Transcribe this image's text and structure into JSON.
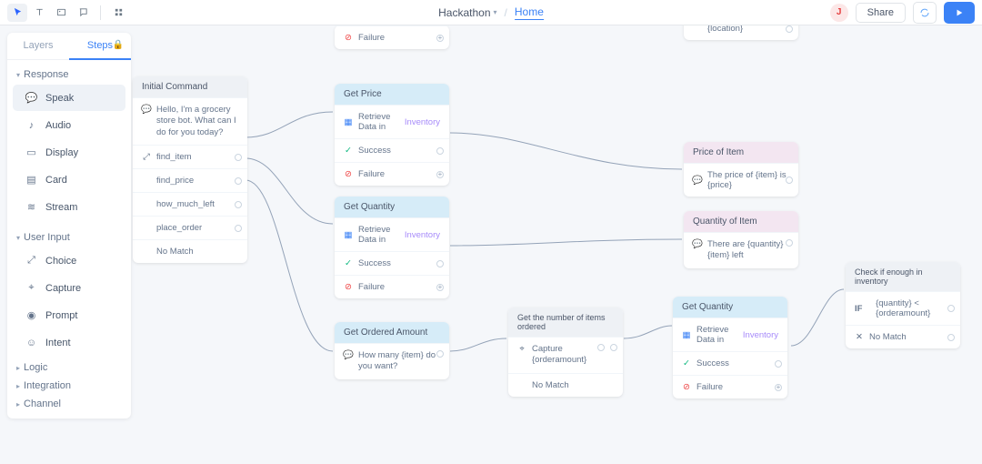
{
  "topbar": {
    "project": "Hackathon",
    "breadcrumb": "Home",
    "share": "Share",
    "avatar": "J"
  },
  "sidebar": {
    "tabs": {
      "layers": "Layers",
      "steps": "Steps"
    },
    "sections": {
      "response": {
        "title": "Response",
        "items": {
          "speak": "Speak",
          "audio": "Audio",
          "display": "Display",
          "card": "Card",
          "stream": "Stream"
        }
      },
      "userinput": {
        "title": "User Input",
        "items": {
          "choice": "Choice",
          "capture": "Capture",
          "prompt": "Prompt",
          "intent": "Intent"
        }
      },
      "logic": "Logic",
      "integration": "Integration",
      "channel": "Channel"
    }
  },
  "nodes": {
    "initial": {
      "title": "Initial Command",
      "greet": "Hello, I'm a grocery store bot. What can I do for you today?",
      "intents": {
        "find_item": "find_item",
        "find_price": "find_price",
        "how_much": "how_much_left",
        "place_order": "place_order",
        "nomatch": "No Match"
      }
    },
    "topfail": {
      "failure": "Failure"
    },
    "getprice": {
      "title": "Get Price",
      "retrieve": "Retrieve Data in ",
      "inventory": "Inventory",
      "success": "Success",
      "failure": "Failure"
    },
    "getqty": {
      "title": "Get Quantity",
      "retrieve": "Retrieve Data in ",
      "inventory": "Inventory",
      "success": "Success",
      "failure": "Failure"
    },
    "getordered": {
      "title": "Get Ordered Amount",
      "prompt": "How many {item} do you want?"
    },
    "capture": {
      "title": "Get the number of items ordered",
      "label": "Capture",
      "var": "{orderamount}",
      "nomatch": "No Match"
    },
    "getqty2": {
      "title": "Get Quantity",
      "retrieve": "Retrieve Data in ",
      "inventory": "Inventory",
      "success": "Success",
      "failure": "Failure"
    },
    "loc": {
      "text": "{location}"
    },
    "priceof": {
      "title": "Price of Item",
      "text": "The price of {item} is {price}"
    },
    "qtyof": {
      "title": "Quantity of Item",
      "text": "There are {quantity} {item} left"
    },
    "check": {
      "title": "Check if enough in inventory",
      "cond": "{quantity} < {orderamount}",
      "if": "IF",
      "nomatch": "No Match"
    }
  }
}
